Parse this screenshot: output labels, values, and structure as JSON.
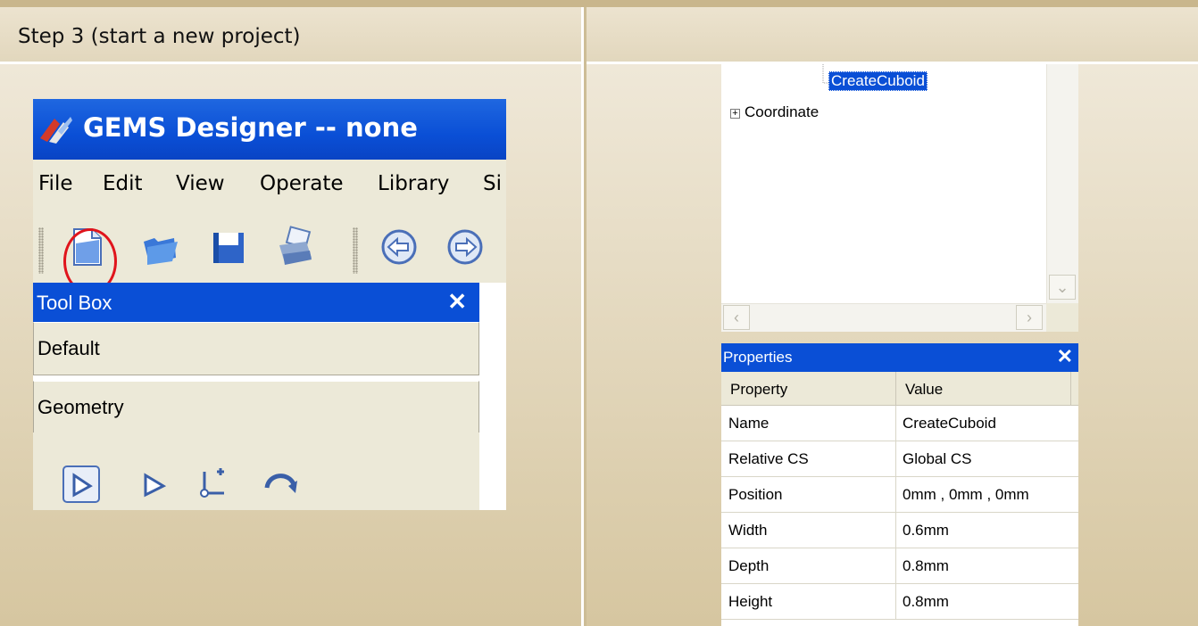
{
  "slide": {
    "title": "Step 3 (start a new project)"
  },
  "app": {
    "title": "GEMS Designer -- none",
    "menu": [
      "File",
      "Edit",
      "View",
      "Operate",
      "Library",
      "Si"
    ],
    "toolbar_icons": [
      "new-project-icon",
      "open-folder-icon",
      "save-icon",
      "print-icon",
      "back-icon",
      "forward-icon"
    ],
    "highlighted_tool": "new-project-icon",
    "highlight_color": "#e0141c"
  },
  "toolbox": {
    "title": "Tool Box",
    "close": "✕",
    "sections": [
      "Default",
      "Geometry"
    ],
    "tools": [
      "select-arrow-icon",
      "pointer-icon",
      "add-point-icon",
      "rotate-icon"
    ]
  },
  "tree": {
    "nodes": [
      {
        "label": "CreateCuboid",
        "selected": true
      },
      {
        "label": "Coordinate",
        "selected": false
      }
    ]
  },
  "properties": {
    "title": "Properties",
    "close": "✕",
    "columns": [
      "Property",
      "Value"
    ],
    "rows": [
      {
        "name": "Name",
        "value": "CreateCuboid"
      },
      {
        "name": "Relative CS",
        "value": "Global CS"
      },
      {
        "name": "Position",
        "value": "0mm , 0mm , 0mm"
      },
      {
        "name": "Width",
        "value": "0.6mm"
      },
      {
        "name": "Depth",
        "value": "0.8mm"
      },
      {
        "name": "Height",
        "value": "0.8mm"
      }
    ]
  },
  "colors": {
    "titlebar": "#0a4fd6",
    "panel": "#ece9d8",
    "slide_bg": "#cdbd96"
  }
}
